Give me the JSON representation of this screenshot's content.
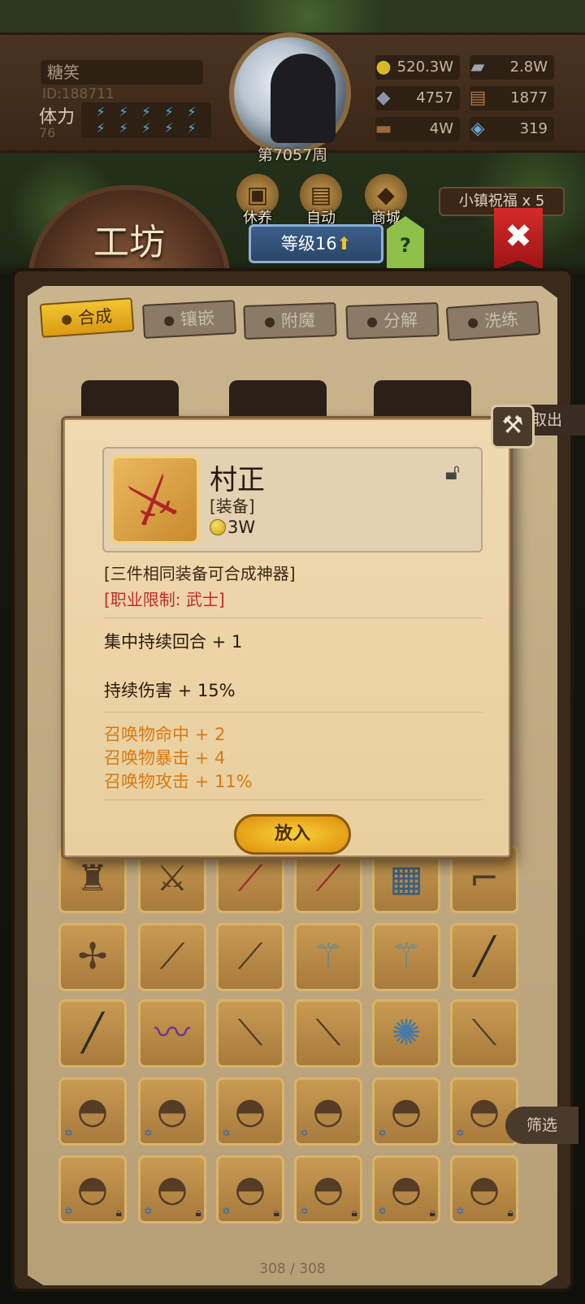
{
  "player": {
    "name": "糖笑",
    "id": "ID:188711",
    "stamina_label": "体力",
    "stamina_value": "76",
    "week": "第7057周"
  },
  "resources": [
    {
      "icon": "gold-coin-icon",
      "glyph": "●",
      "color": "#d9b92a",
      "value": "520.3W"
    },
    {
      "icon": "iron-ingot-icon",
      "glyph": "▰",
      "color": "#9aa6b2",
      "value": "2.8W"
    },
    {
      "icon": "ore-icon",
      "glyph": "◆",
      "color": "#8a96a6",
      "value": "4757"
    },
    {
      "icon": "cloth-icon",
      "glyph": "▤",
      "color": "#b07a4a",
      "value": "1877"
    },
    {
      "icon": "wood-icon",
      "glyph": "▬",
      "color": "#9a6a3a",
      "value": "4W"
    },
    {
      "icon": "crystal-icon",
      "glyph": "◈",
      "color": "#6aa6d6",
      "value": "319"
    }
  ],
  "nav": {
    "rest": "休养",
    "auto": "自动",
    "shop": "商城",
    "blessing": "小镇祝福 x 5"
  },
  "workshop": {
    "title": "工坊",
    "level": "等级16",
    "help": "?"
  },
  "tabs": [
    {
      "label": "合成",
      "active": true
    },
    {
      "label": "镶嵌",
      "active": false
    },
    {
      "label": "附魔",
      "active": false
    },
    {
      "label": "分解",
      "active": false
    },
    {
      "label": "洗练",
      "active": false
    }
  ],
  "take_out": "取出",
  "filter": "筛选",
  "inventory_count": "308 / 308",
  "dialog": {
    "item_name": "村正",
    "item_type": "[装备]",
    "item_price": "3W",
    "craft_note": "[三件相同装备可合成神器]",
    "class_limit": "[职业限制: 武士]",
    "stats_main": [
      "集中持续回合 + 1",
      "持续伤害 + 15%"
    ],
    "stats_bonus": [
      "召唤物命中 + 2",
      "召唤物暴击 + 4",
      "召唤物攻击 + 11%"
    ],
    "place_button": "放入"
  },
  "colors": {
    "craft_note": "#3a2a18",
    "class_limit": "#c22a2a",
    "stats_main": "#2a1a0c",
    "stats_bonus": "#d87a14"
  }
}
